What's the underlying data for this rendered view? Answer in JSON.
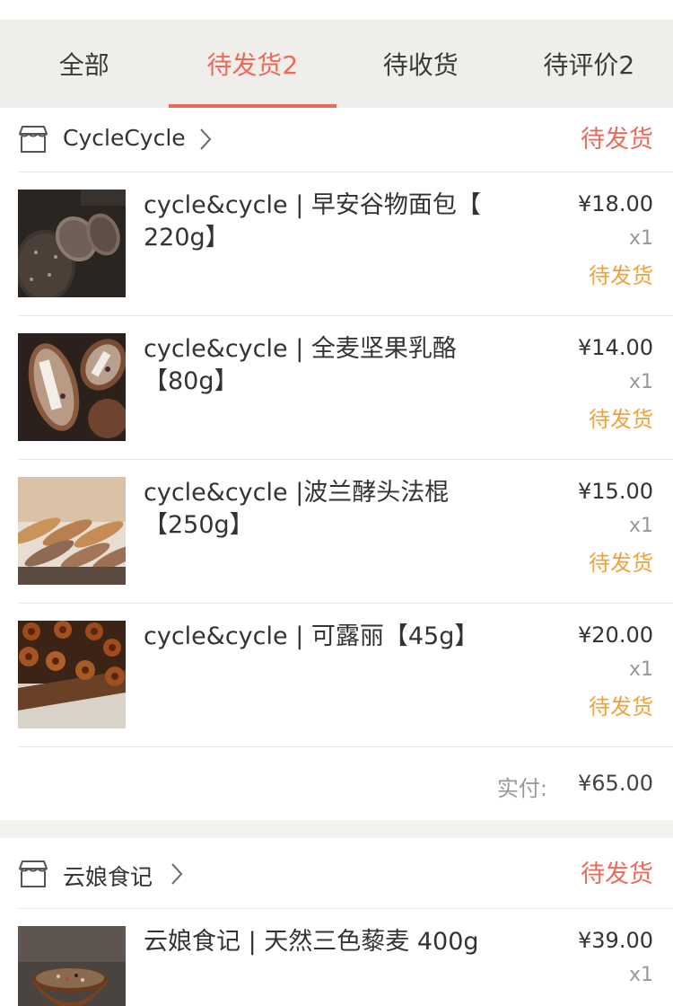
{
  "tabs": [
    {
      "label": "全部"
    },
    {
      "label": "待发货2"
    },
    {
      "label": "待收货"
    },
    {
      "label": "待评价2"
    }
  ],
  "accent_color": "#ea6b5a",
  "status_color": "#f0a23a",
  "orders": [
    {
      "shop_name": "CycleCycle",
      "status": "待发货",
      "items": [
        {
          "title": "cycle&cycle | 早安谷物面包【 220g】",
          "price": "¥18.00",
          "qty": "x1",
          "status": "待发货",
          "thumb_icon": "grain-bread-photo"
        },
        {
          "title": "cycle&cycle | 全麦坚果乳酪【80g】",
          "price": "¥14.00",
          "qty": "x1",
          "status": "待发货",
          "thumb_icon": "cheese-bread-photo"
        },
        {
          "title": "cycle&cycle |波兰酵头法棍【250g】",
          "price": "¥15.00",
          "qty": "x1",
          "status": "待发货",
          "thumb_icon": "baguette-photo"
        },
        {
          "title": "cycle&cycle | 可露丽【45g】",
          "price": "¥20.00",
          "qty": "x1",
          "status": "待发货",
          "thumb_icon": "canele-photo"
        }
      ],
      "total_label": "实付:",
      "total_value": "¥65.00"
    },
    {
      "shop_name": "云娘食记",
      "status": "待发货",
      "items": [
        {
          "title": "云娘食记 | 天然三色藜麦 400g",
          "price": "¥39.00",
          "qty": "x1",
          "thumb_icon": "quinoa-bowl-photo"
        }
      ]
    }
  ]
}
